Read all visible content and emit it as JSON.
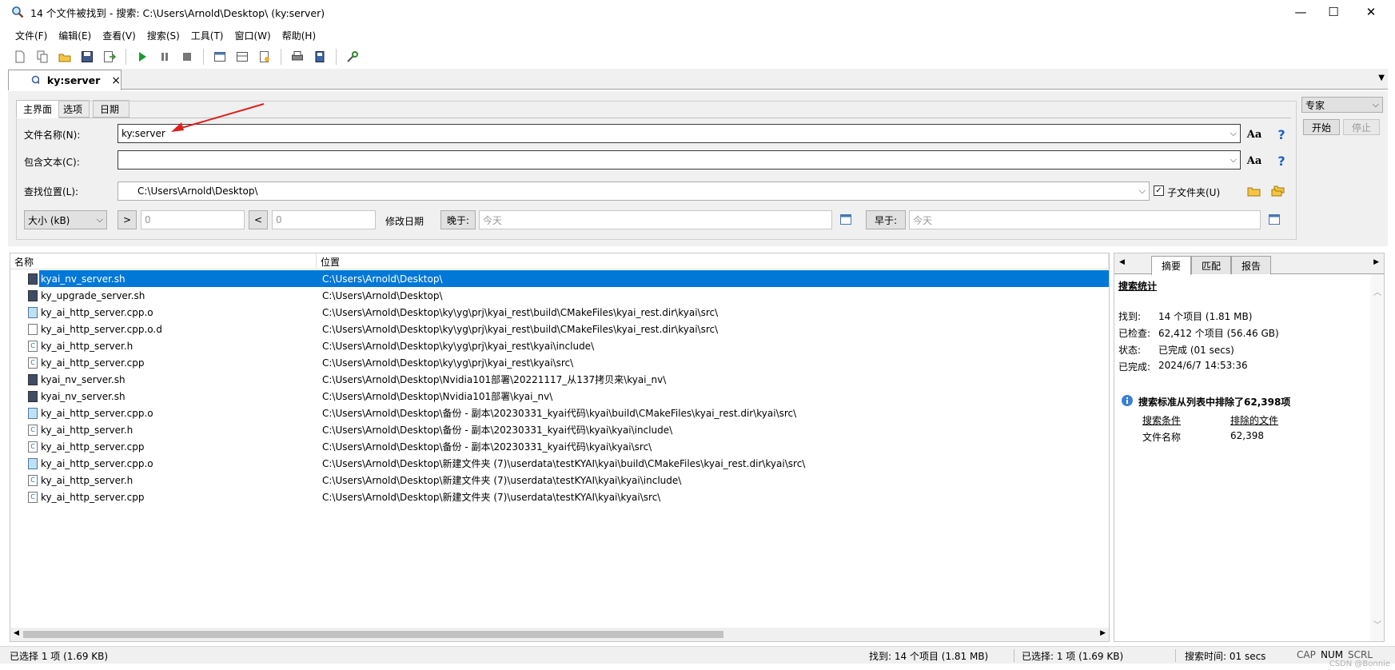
{
  "window": {
    "title": "14 个文件被找到 - 搜索: C:\\Users\\Arnold\\Desktop\\ (ky:server)",
    "minimize": "—",
    "maximize": "☐",
    "close": "✕"
  },
  "menu": [
    "文件(F)",
    "编辑(E)",
    "查看(V)",
    "搜索(S)",
    "工具(T)",
    "窗口(W)",
    "帮助(H)"
  ],
  "doc_tab": {
    "label": "ky:server",
    "close": "×"
  },
  "search": {
    "subtabs": [
      "主界面",
      "选项",
      "日期"
    ],
    "filename_label": "文件名称(N):",
    "filename_value": "ky:server",
    "contains_label": "包含文本(C):",
    "contains_value": "",
    "location_label": "查找位置(L):",
    "location_value": "C:\\Users\\Arnold\\Desktop\\",
    "subfolders_label": "子文件夹(U)",
    "subfolders_checked": true,
    "size_unit": "大小 (kB)",
    "gt": ">",
    "lt": "<",
    "size_min": "0",
    "size_max": "0",
    "modified_label": "修改日期",
    "after_label": "晚于:",
    "after_value": "今天",
    "before_label": "早于:",
    "before_value": "今天",
    "mode": "专家",
    "start": "开始",
    "stop": "停止"
  },
  "results": {
    "columns": [
      "名称",
      "位置"
    ],
    "rows": [
      {
        "name": "kyai_nv_server.sh",
        "path": "C:\\Users\\Arnold\\Desktop\\",
        "type": "sh"
      },
      {
        "name": "ky_upgrade_server.sh",
        "path": "C:\\Users\\Arnold\\Desktop\\",
        "type": "sh"
      },
      {
        "name": "ky_ai_http_server.cpp.o",
        "path": "C:\\Users\\Arnold\\Desktop\\ky\\yg\\prj\\kyai_rest\\build\\CMakeFiles\\kyai_rest.dir\\kyai\\src\\",
        "type": "o"
      },
      {
        "name": "ky_ai_http_server.cpp.o.d",
        "path": "C:\\Users\\Arnold\\Desktop\\ky\\yg\\prj\\kyai_rest\\build\\CMakeFiles\\kyai_rest.dir\\kyai\\src\\",
        "type": "d"
      },
      {
        "name": "ky_ai_http_server.h",
        "path": "C:\\Users\\Arnold\\Desktop\\ky\\yg\\prj\\kyai_rest\\kyai\\include\\",
        "type": "c"
      },
      {
        "name": "ky_ai_http_server.cpp",
        "path": "C:\\Users\\Arnold\\Desktop\\ky\\yg\\prj\\kyai_rest\\kyai\\src\\",
        "type": "c"
      },
      {
        "name": "kyai_nv_server.sh",
        "path": "C:\\Users\\Arnold\\Desktop\\Nvidia101部署\\20221117_从137拷贝来\\kyai_nv\\",
        "type": "sh"
      },
      {
        "name": "kyai_nv_server.sh",
        "path": "C:\\Users\\Arnold\\Desktop\\Nvidia101部署\\kyai_nv\\",
        "type": "sh"
      },
      {
        "name": "ky_ai_http_server.cpp.o",
        "path": "C:\\Users\\Arnold\\Desktop\\备份 - 副本\\20230331_kyai代码\\kyai\\build\\CMakeFiles\\kyai_rest.dir\\kyai\\src\\",
        "type": "o"
      },
      {
        "name": "ky_ai_http_server.h",
        "path": "C:\\Users\\Arnold\\Desktop\\备份 - 副本\\20230331_kyai代码\\kyai\\kyai\\include\\",
        "type": "c"
      },
      {
        "name": "ky_ai_http_server.cpp",
        "path": "C:\\Users\\Arnold\\Desktop\\备份 - 副本\\20230331_kyai代码\\kyai\\kyai\\src\\",
        "type": "c"
      },
      {
        "name": "ky_ai_http_server.cpp.o",
        "path": "C:\\Users\\Arnold\\Desktop\\新建文件夹 (7)\\userdata\\testKYAI\\kyai\\build\\CMakeFiles\\kyai_rest.dir\\kyai\\src\\",
        "type": "o"
      },
      {
        "name": "ky_ai_http_server.h",
        "path": "C:\\Users\\Arnold\\Desktop\\新建文件夹 (7)\\userdata\\testKYAI\\kyai\\kyai\\include\\",
        "type": "c"
      },
      {
        "name": "ky_ai_http_server.cpp",
        "path": "C:\\Users\\Arnold\\Desktop\\新建文件夹 (7)\\userdata\\testKYAI\\kyai\\kyai\\src\\",
        "type": "c"
      }
    ]
  },
  "summary": {
    "tabs": [
      "摘要",
      "匹配",
      "报告"
    ],
    "heading": "搜索统计",
    "found_label": "找到:",
    "found_value": "14 个项目 (1.81 MB)",
    "checked_label": "已检查:",
    "checked_value": "62,412 个项目 (56.46 GB)",
    "state_label": "状态:",
    "state_value": "已完成 (01 secs)",
    "done_label": "已完成:",
    "done_value": "2024/6/7 14:53:36",
    "excluded_text": "搜索标准从列表中排除了62,398项",
    "criteria_header": "搜索条件",
    "excluded_header": "排除的文件",
    "criteria_value": "文件名称",
    "excluded_value": "62,398"
  },
  "status": {
    "selected": "已选择 1 项 (1.69 KB)",
    "found": "找到: 14 个项目 (1.81 MB)",
    "selected2": "已选择: 1 项 (1.69 KB)",
    "time": "搜索时间: 01 secs",
    "cap": "CAP",
    "num": "NUM",
    "scrl": "SCRL",
    "watermark": "CSDN @Bonnie"
  },
  "colors": {
    "selection": "#0078d7",
    "arrow": "#e0201c",
    "help": "#1a62c8"
  }
}
